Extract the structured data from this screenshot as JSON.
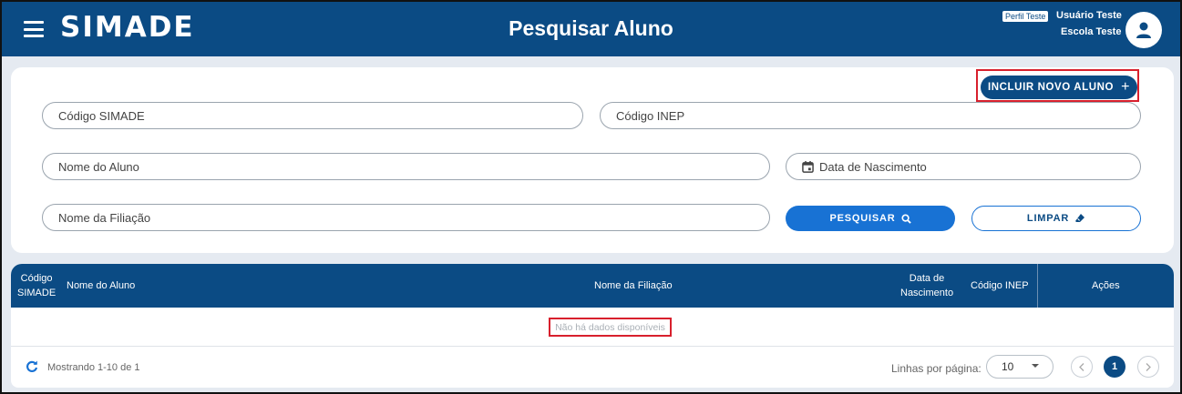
{
  "header": {
    "logo": "SIMADE",
    "title": "Pesquisar Aluno",
    "profile_badge": "Perfil Teste",
    "user_name": "Usuário Teste",
    "school_name": "Escola Teste",
    "menu_icon": "hamburger-menu-icon",
    "avatar_icon": "person-icon"
  },
  "search": {
    "new_student_label": "INCLUIR NOVO ALUNO",
    "new_student_icon": "plus-icon",
    "code_simade_placeholder": "Código SIMADE",
    "code_inep_placeholder": "Código INEP",
    "student_name_placeholder": "Nome do Aluno",
    "birth_date_placeholder": "Data de Nascimento",
    "birth_date_icon": "calendar-icon",
    "filiation_placeholder": "Nome da Filiação",
    "search_label": "PESQUISAR",
    "search_icon": "search-icon",
    "clear_label": "LIMPAR",
    "clear_icon": "eraser-icon"
  },
  "table": {
    "columns": {
      "code_simade_line1": "Código",
      "code_simade_line2": "SIMADE",
      "student_name": "Nome do Aluno",
      "filiation": "Nome da Filiação",
      "birth_date_line1": "Data de",
      "birth_date_line2": "Nascimento",
      "code_inep": "Código INEP",
      "actions": "Ações"
    },
    "empty_message": "Não há dados disponíveis"
  },
  "footer": {
    "showing": "Mostrando 1-10 de 1",
    "rows_per_page_label": "Linhas por página:",
    "rows_per_page_value": "10",
    "current_page": "1",
    "prev_icon": "chevron-left-icon",
    "next_icon": "chevron-right-icon",
    "refresh_icon": "refresh-icon"
  },
  "colors": {
    "primary": "#0b4b84",
    "accent": "#1872d4",
    "highlight": "#d8202d",
    "background": "#e5eaf1"
  }
}
